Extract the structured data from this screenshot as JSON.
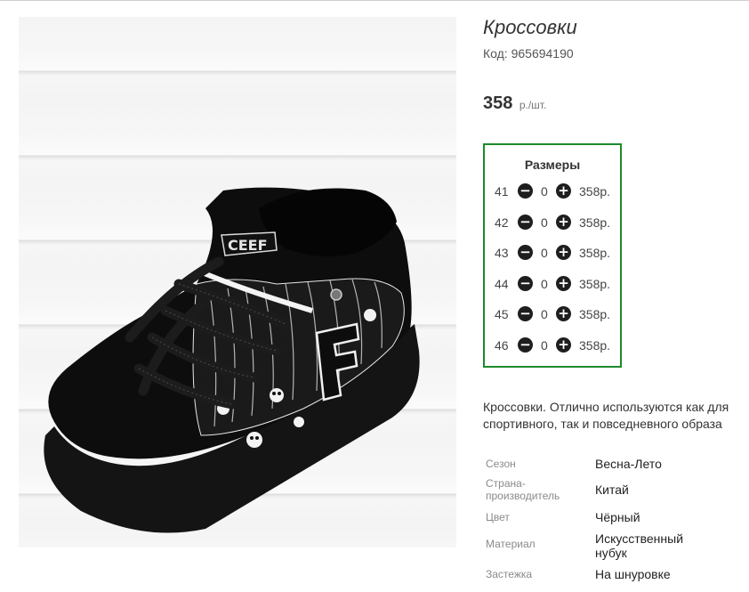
{
  "product": {
    "title": "Кроссовки",
    "code_label": "Код:",
    "code_value": "965694190",
    "price": {
      "value": "358",
      "unit": "р./шт."
    },
    "description": "Кроссовки. Отлично используются как для спортивного, так и повседневного образа"
  },
  "sizes": {
    "title": "Размеры",
    "minus_icon": "minus-circle-icon",
    "plus_icon": "plus-circle-icon",
    "rows": [
      {
        "size": "41",
        "qty": "0",
        "price": "358р."
      },
      {
        "size": "42",
        "qty": "0",
        "price": "358р."
      },
      {
        "size": "43",
        "qty": "0",
        "price": "358р."
      },
      {
        "size": "44",
        "qty": "0",
        "price": "358р."
      },
      {
        "size": "45",
        "qty": "0",
        "price": "358р."
      },
      {
        "size": "46",
        "qty": "0",
        "price": "358р."
      }
    ]
  },
  "specs": [
    {
      "label": "Сезон",
      "value": "Весна-Лето"
    },
    {
      "label": "Страна-производитель",
      "value": "Китай"
    },
    {
      "label": "Цвет",
      "value": "Чёрный"
    },
    {
      "label": "Материал",
      "value": "Искусственный нубук"
    },
    {
      "label": "Застежка",
      "value": "На шнуровке"
    }
  ],
  "colors": {
    "accent_border": "#1c8a2b",
    "button_fill": "#1e1e1e"
  }
}
